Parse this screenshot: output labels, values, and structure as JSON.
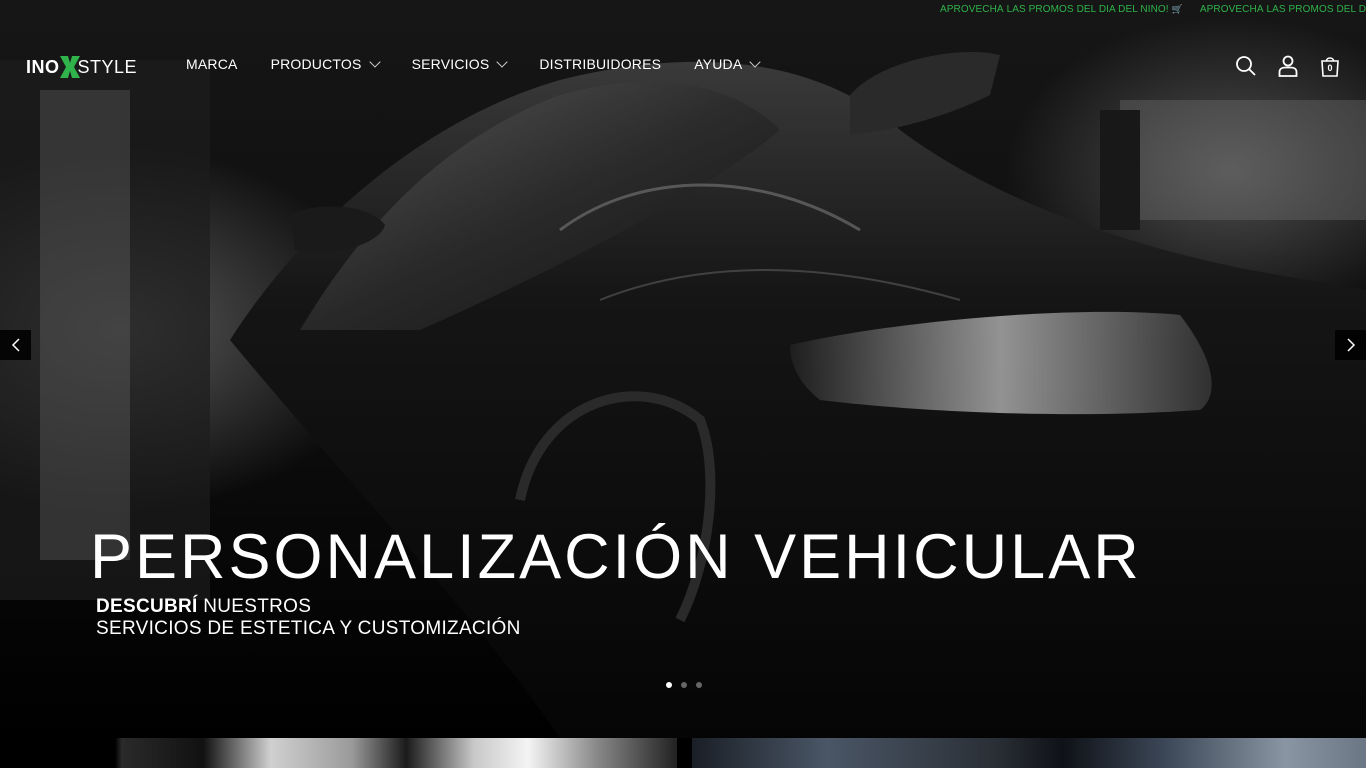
{
  "promo": {
    "message_1": "APROVECHÁ LAS PROMOS DEL DIA DEL NIÑO!",
    "message_2": "APROVECHÁ LAS PROMOS DEL DI",
    "cart_icon": "shopping-cart-icon"
  },
  "brand": {
    "logo_left": "INO",
    "logo_right": "STYLE",
    "accent_color": "#2fb34a"
  },
  "nav": {
    "items": [
      {
        "label": "MARCA",
        "has_dropdown": false
      },
      {
        "label": "PRODUCTOS",
        "has_dropdown": true
      },
      {
        "label": "SERVICIOS",
        "has_dropdown": true
      },
      {
        "label": "DISTRIBUIDORES",
        "has_dropdown": false
      },
      {
        "label": "AYUDA",
        "has_dropdown": true
      }
    ]
  },
  "header_icons": {
    "search": "search-icon",
    "account": "user-icon",
    "cart": "shopping-bag-icon",
    "cart_count": "0"
  },
  "hero": {
    "title": "PERSONALIZACIÓN VEHICULAR",
    "subtitle_bold": "DESCUBRÍ",
    "subtitle_rest": " NUESTROS",
    "subtitle_line2": "SERVICIOS DE ESTETICA Y CUSTOMIZACIÓN",
    "slide_count": 3,
    "active_slide": 1,
    "prev_icon": "chevron-left-icon",
    "next_icon": "chevron-right-icon"
  }
}
